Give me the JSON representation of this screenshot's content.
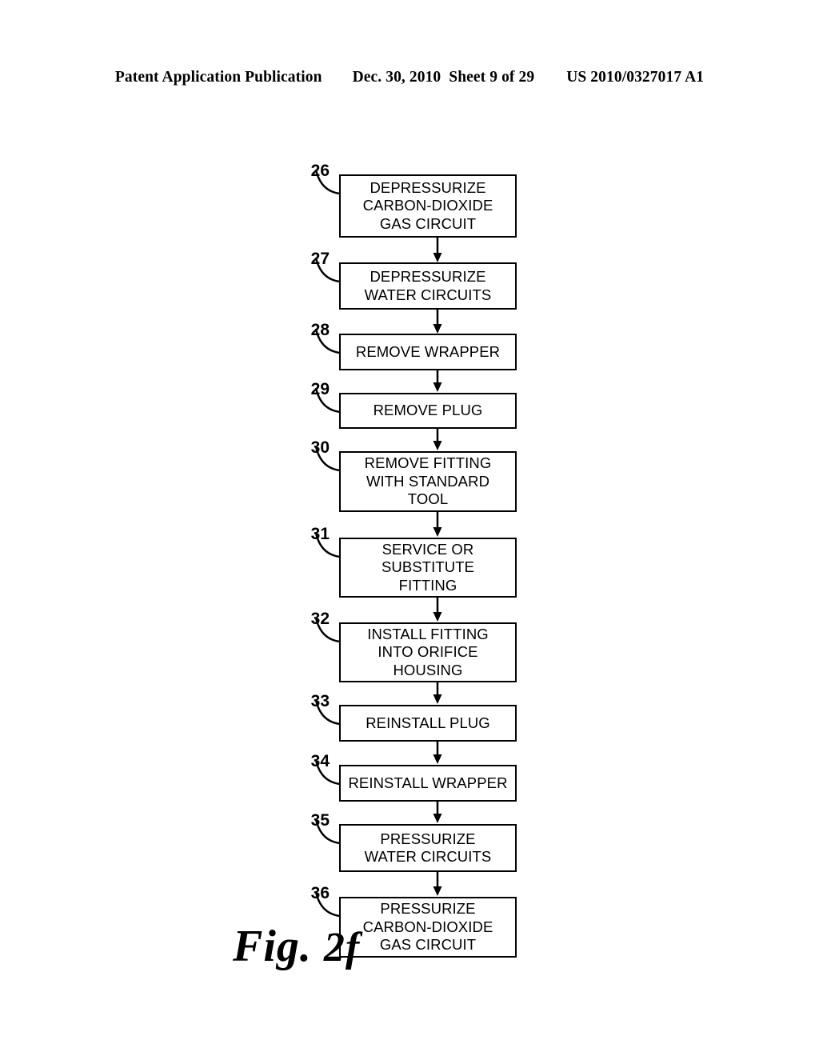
{
  "header": {
    "publication": "Patent Application Publication",
    "date": "Dec. 30, 2010",
    "sheet": "Sheet 9 of 29",
    "patent_number": "US 2010/0327017 A1"
  },
  "figure": {
    "caption": "Fig. 2f",
    "caption_prefix": "Fig. ",
    "caption_number": "2f"
  },
  "flowchart": {
    "type": "process-flow",
    "direction": "top-to-bottom",
    "steps": [
      {
        "ref": "26",
        "label": "DEPRESSURIZE\nCARBON-DIOXIDE\nGAS CIRCUIT",
        "lines": 3
      },
      {
        "ref": "27",
        "label": "DEPRESSURIZE\nWATER CIRCUITS",
        "lines": 2
      },
      {
        "ref": "28",
        "label": "REMOVE WRAPPER",
        "lines": 1
      },
      {
        "ref": "29",
        "label": "REMOVE PLUG",
        "lines": 1
      },
      {
        "ref": "30",
        "label": "REMOVE FITTING\nWITH STANDARD\nTOOL",
        "lines": 3
      },
      {
        "ref": "31",
        "label": "SERVICE OR\nSUBSTITUTE\nFITTING",
        "lines": 3
      },
      {
        "ref": "32",
        "label": "INSTALL FITTING\nINTO ORIFICE\nHOUSING",
        "lines": 3
      },
      {
        "ref": "33",
        "label": "REINSTALL PLUG",
        "lines": 1
      },
      {
        "ref": "34",
        "label": "REINSTALL WRAPPER",
        "lines": 1
      },
      {
        "ref": "35",
        "label": "PRESSURIZE\nWATER CIRCUITS",
        "lines": 2
      },
      {
        "ref": "36",
        "label": "PRESSURIZE\nCARBON-DIOXIDE\nGAS CIRCUIT",
        "lines": 3
      }
    ]
  },
  "colors": {
    "ink": "#000000",
    "page": "#ffffff"
  }
}
